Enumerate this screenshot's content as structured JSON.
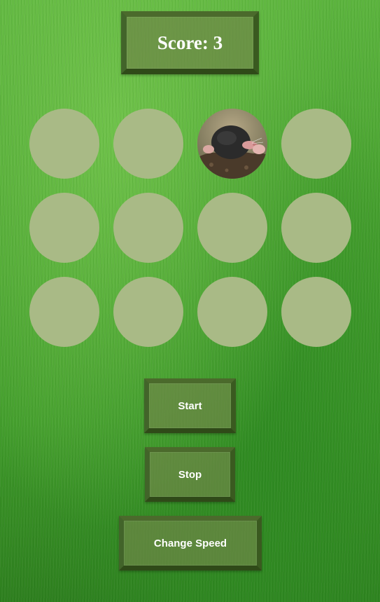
{
  "score": {
    "text": "Score: 3",
    "value": 3
  },
  "board": {
    "rows": 3,
    "columns": 4,
    "active_hole": 3,
    "hole_color": "#a9ba86"
  },
  "buttons": {
    "start_label": "Start",
    "stop_label": "Stop",
    "change_speed_label": "Change Speed"
  }
}
